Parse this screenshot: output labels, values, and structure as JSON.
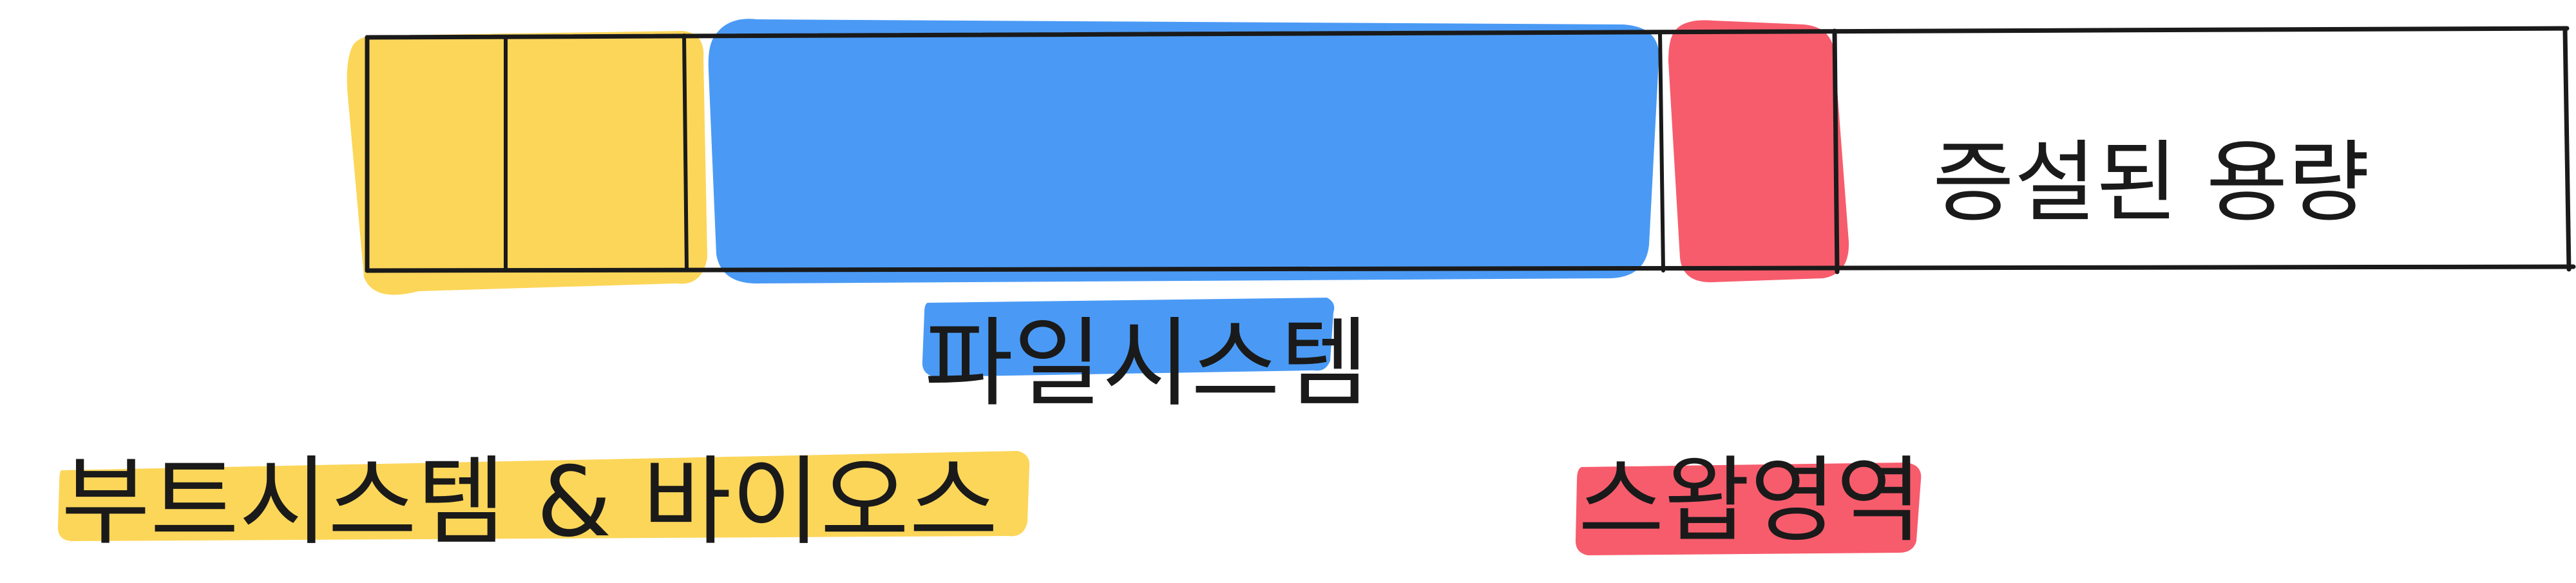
{
  "diagram": {
    "segments": [
      {
        "id": "boot",
        "label": "부트시스템 & 바이오스",
        "color": "#fcd659"
      },
      {
        "id": "filesystem",
        "label": "파일시스템",
        "color": "#4a9af5"
      },
      {
        "id": "swap",
        "label": "스왑영역",
        "color": "#f75c6c"
      },
      {
        "id": "capacity",
        "label": "증설된 용량",
        "color": "#ffffff"
      }
    ]
  }
}
